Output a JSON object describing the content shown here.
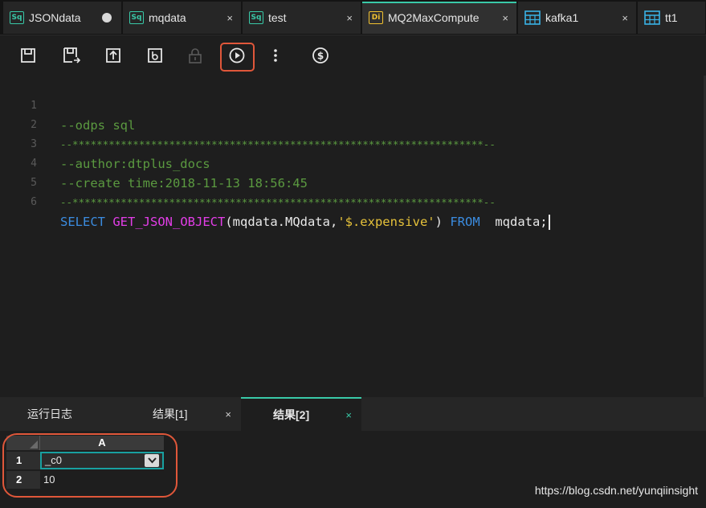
{
  "tabs": [
    {
      "label": "JSONdata",
      "badge": "Sq",
      "state": "dot"
    },
    {
      "label": "mqdata",
      "badge": "Sq",
      "state": "close"
    },
    {
      "label": "test",
      "badge": "Sq",
      "state": "close"
    },
    {
      "label": "MQ2MaxCompute",
      "badge": "Di",
      "state": "close"
    },
    {
      "label": "kafka1",
      "badge": "table-icon",
      "state": "close"
    },
    {
      "label": "tt1",
      "badge": "table-icon",
      "state": "none"
    }
  ],
  "close_glyph": "×",
  "toolbar": {
    "icons": [
      "save-icon",
      "save-as-icon",
      "upload-icon",
      "download-icon",
      "lock-icon",
      "run-icon",
      "more-icon",
      "cost-icon"
    ]
  },
  "editor": {
    "line_numbers": [
      "1",
      "2",
      "3",
      "4",
      "5",
      "6"
    ],
    "lines": [
      "--odps sql",
      "--********************************************************************--",
      "--author:dtplus_docs",
      "--create time:2018-11-13 18:56:45",
      "--********************************************************************--"
    ],
    "sql": {
      "select": "SELECT",
      "fn": "GET_JSON_OBJECT",
      "open": "(mqdata.MQdata,",
      "str": "'$.expensive'",
      "close": ")",
      "from": "FROM",
      "tail": "  mqdata;"
    }
  },
  "bottom_tabs": [
    {
      "label": "运行日志"
    },
    {
      "label": "结果[1]"
    },
    {
      "label": "结果[2]"
    }
  ],
  "result_grid": {
    "column_header": "A",
    "rows": [
      {
        "num": "1",
        "value": "_c0"
      },
      {
        "num": "2",
        "value": "10"
      }
    ]
  },
  "watermark": "https://blog.csdn.net/yunqiinsight",
  "colors": {
    "accent": "#39c9a8",
    "highlight": "#e0573a",
    "keyword": "#3b8ce0",
    "function": "#e33de8",
    "string": "#e6c23a",
    "comment": "#5b9a40"
  }
}
